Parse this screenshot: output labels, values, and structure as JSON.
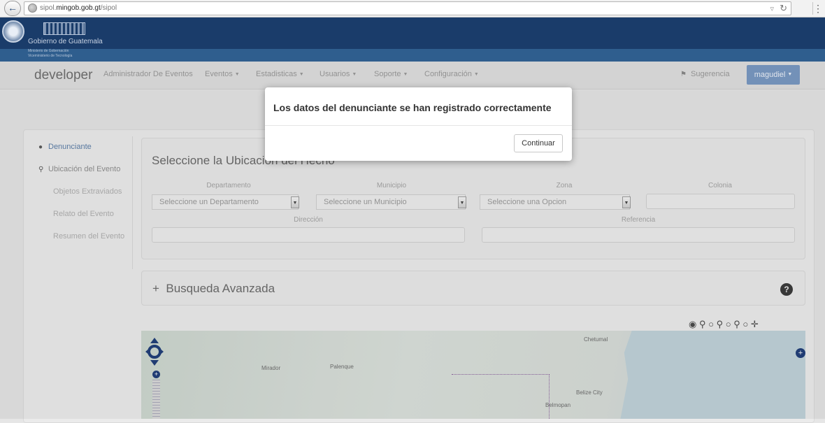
{
  "browser": {
    "url_prefix": "sipol.",
    "url_domain": "mingob.gob.gt",
    "url_path": "/sipol",
    "back_icon": "back-arrow-icon",
    "reload_icon": "reload-icon"
  },
  "gov_header": {
    "name": "Gobierno de Guatemala",
    "sub1": "Ministerio de Gobernación",
    "sub2": "Viceministerio de Tecnología"
  },
  "navbar": {
    "brand": "developer",
    "items": [
      {
        "label": "Administrador De Eventos",
        "dropdown": false
      },
      {
        "label": "Eventos",
        "dropdown": true
      },
      {
        "label": "Estadisticas",
        "dropdown": true
      },
      {
        "label": "Usuarios",
        "dropdown": true
      },
      {
        "label": "Soporte",
        "dropdown": true
      },
      {
        "label": "Configuración",
        "dropdown": true
      }
    ],
    "suggestion": "Sugerencia",
    "user": "magudiel"
  },
  "sidebar": {
    "items": [
      {
        "label": "Denunciante",
        "icon": "user-icon"
      },
      {
        "label": "Ubicación del Evento",
        "icon": "map-marker-icon"
      },
      {
        "label": "Objetos Extraviados"
      },
      {
        "label": "Relato del Evento"
      },
      {
        "label": "Resumen del Evento"
      }
    ]
  },
  "location": {
    "title": "Seleccione la Ubicación del Hecho",
    "labels": {
      "departamento": "Departamento",
      "municipio": "Municipio",
      "zona": "Zona",
      "colonia": "Colonia",
      "direccion": "Dirección",
      "referencia": "Referencia"
    },
    "selects": {
      "departamento": "Seleccione un Departamento",
      "municipio": "Seleccione un Municipio",
      "zona": "Seleccione una Opcion"
    }
  },
  "advanced": {
    "title": "Busqueda Avanzada",
    "toggle": "+",
    "help": "?"
  },
  "map": {
    "labels": [
      "Chetumal",
      "Mirador",
      "Palenque",
      "Belize City",
      "Belmopan"
    ]
  },
  "modal": {
    "message": "Los datos del denunciante se han registrado correctamente",
    "button": "Continuar"
  }
}
